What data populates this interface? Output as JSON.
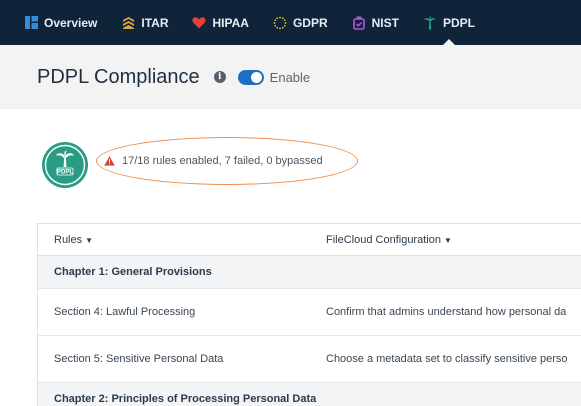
{
  "nav": {
    "tabs": [
      {
        "label": "Overview",
        "icon": "dashboard-icon",
        "color": "#2f8fd8"
      },
      {
        "label": "ITAR",
        "icon": "chevron-rank-icon",
        "color": "#e0a53a"
      },
      {
        "label": "HIPAA",
        "icon": "heart-icon",
        "color": "#e0403a"
      },
      {
        "label": "GDPR",
        "icon": "eu-stars-icon",
        "color": "#e6c228"
      },
      {
        "label": "NIST",
        "icon": "nist-shield-icon",
        "color": "#b057d8"
      },
      {
        "label": "PDPL",
        "icon": "palm-tree-icon",
        "color": "#2bb59a",
        "active": true
      }
    ]
  },
  "header": {
    "title": "PDPL Compliance",
    "toggle_label": "Enable",
    "toggle_on": true,
    "accent": "#1e6fc1"
  },
  "badge": {
    "text": "PDPL",
    "color": "#2a9c86"
  },
  "status": {
    "text": "17/18 rules enabled, 7 failed, 0 bypassed",
    "warn_color": "#d6452d"
  },
  "table": {
    "headers": [
      "Rules",
      "FileCloud Configuration"
    ],
    "rows": [
      {
        "type": "chapter",
        "rule": "Chapter 1: General Provisions",
        "config": ""
      },
      {
        "type": "section",
        "rule": "Section 4: Lawful Processing",
        "config": "Confirm that admins understand how personal da"
      },
      {
        "type": "section",
        "rule": "Section 5: Sensitive Personal Data",
        "config": "Choose a metadata set to classify sensitive perso"
      },
      {
        "type": "chapter",
        "rule": "Chapter 2: Principles of Processing Personal Data",
        "config": ""
      }
    ]
  }
}
